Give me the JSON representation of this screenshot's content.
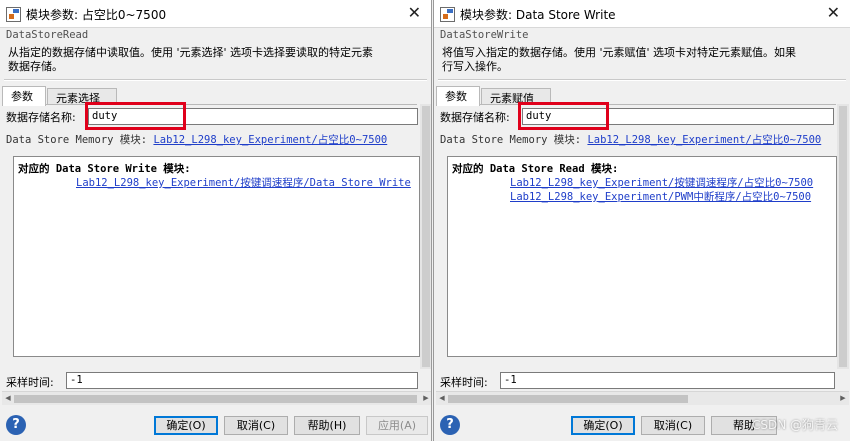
{
  "left": {
    "title": "模块参数: 占空比0~7500",
    "block_name": "DataStoreRead",
    "description": "从指定的数据存储中读取值。使用 '元素选择' 选项卡选择要读取的特定元素\n数据存储。",
    "tabs": [
      "参数",
      "元素选择"
    ],
    "store_label": "数据存储名称:",
    "store_value": "duty",
    "memory_prefix": "Data Store Memory 模块:",
    "memory_link": "Lab12_L298_key_Experiment/占空比0~7500",
    "list_heading": "对应的 Data Store Write 模块:",
    "list_links": [
      "Lab12_L298_key_Experiment/按键调速程序/Data Store Write"
    ],
    "sample_label": "采样时间:",
    "sample_value": "-1",
    "buttons": {
      "ok": "确定(O)",
      "cancel": "取消(C)",
      "help": "帮助(H)",
      "apply": "应用(A)"
    }
  },
  "right": {
    "title": "模块参数: Data Store Write",
    "block_name": "DataStoreWrite",
    "description": "将值写入指定的数据存储。使用 '元素赋值' 选项卡对特定元素赋值。如果\n行写入操作。",
    "tabs": [
      "参数",
      "元素赋值"
    ],
    "store_label": "数据存储名称:",
    "store_value": "duty",
    "memory_prefix": "Data Store Memory 模块:",
    "memory_link": "Lab12_L298_key_Experiment/占空比0~7500",
    "list_heading": "对应的 Data Store Read 模块:",
    "list_links": [
      "Lab12_L298_key_Experiment/按键调速程序/占空比0~7500",
      "Lab12_L298_key_Experiment/PWM中断程序/占空比0~7500"
    ],
    "sample_label": "采样时间:",
    "sample_value": "-1",
    "buttons": {
      "ok": "确定(O)",
      "cancel": "取消(C)",
      "help": "帮助"
    }
  },
  "watermark": "CSDN @狗青云",
  "colors": {
    "highlight": "#e0001b",
    "link": "#1f3ec9",
    "help_icon": "#2b62b3",
    "default_button_border": "#0078d7"
  },
  "icons": {
    "close": "close-icon",
    "help": "help-icon",
    "app": "simulink-block-icon"
  }
}
